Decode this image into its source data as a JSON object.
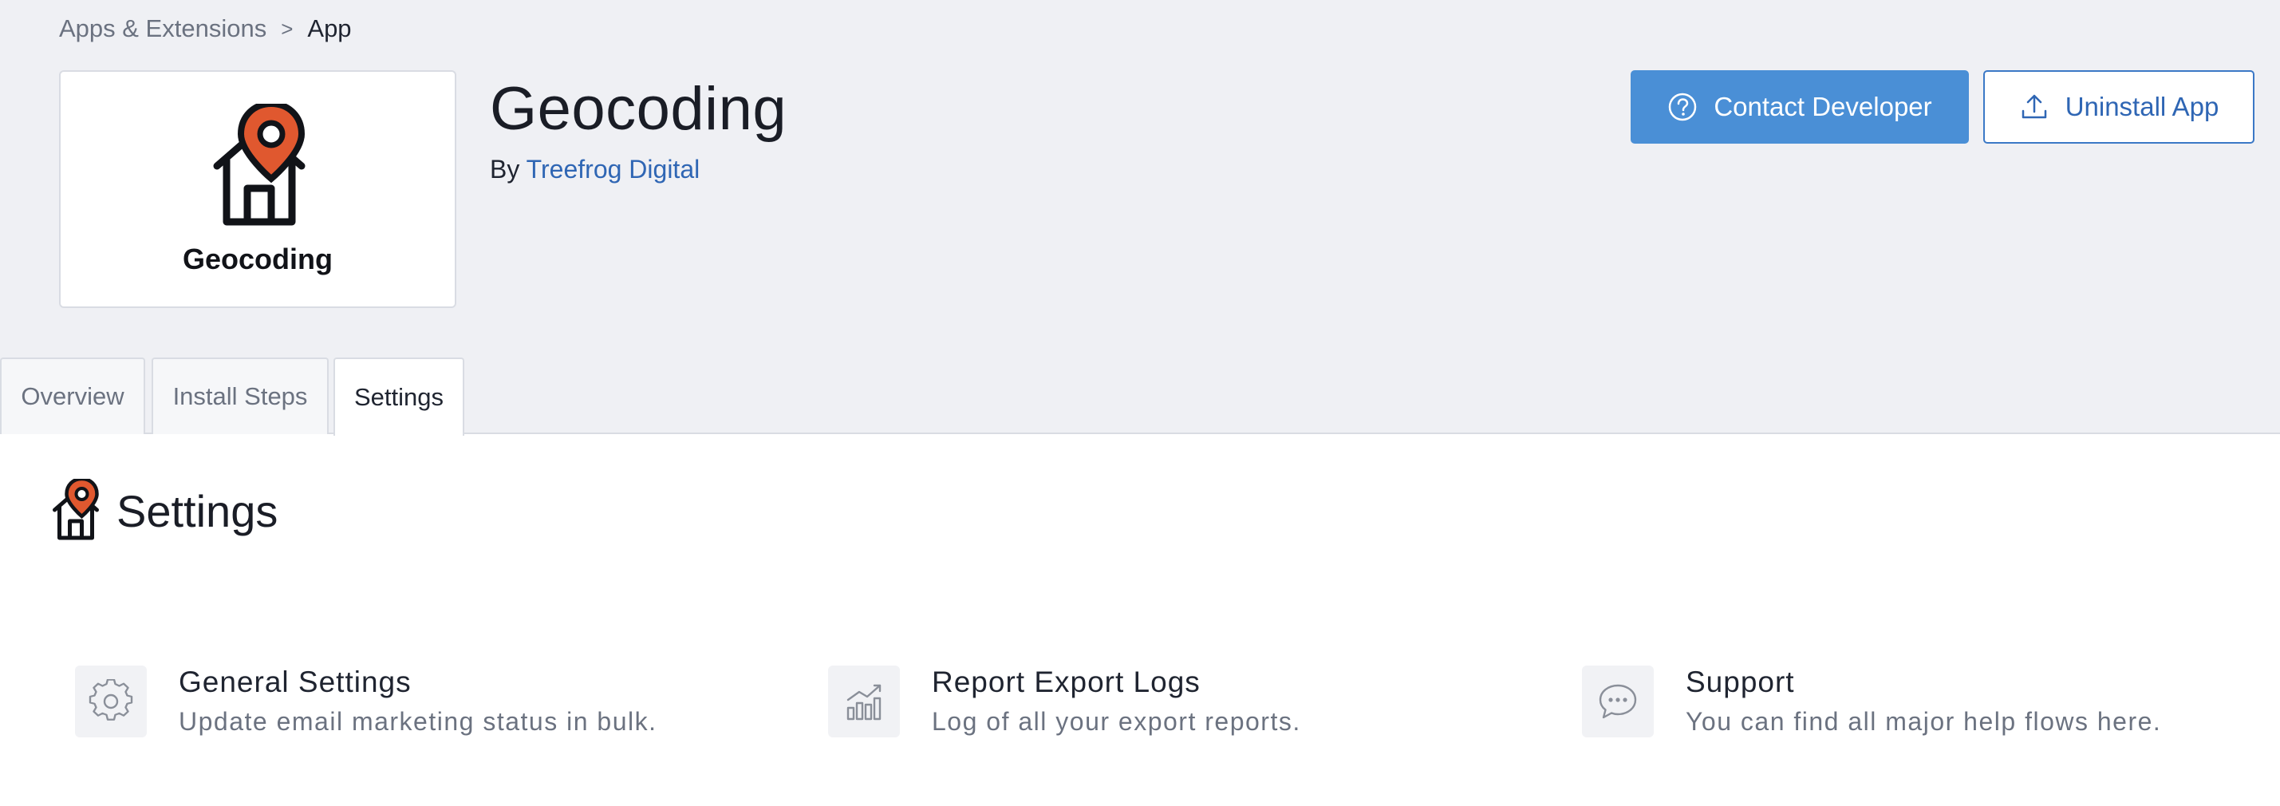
{
  "breadcrumb": {
    "parent": "Apps & Extensions",
    "separator": ">",
    "current": "App"
  },
  "app": {
    "logo_text": "Geocoding",
    "title": "Geocoding",
    "by_prefix": "By",
    "developer": "Treefrog Digital"
  },
  "actions": {
    "contact_label": "Contact Developer",
    "uninstall_label": "Uninstall App"
  },
  "tabs": [
    {
      "label": "Overview",
      "active": false
    },
    {
      "label": "Install Steps",
      "active": false
    },
    {
      "label": "Settings",
      "active": true
    }
  ],
  "section": {
    "title": "Settings"
  },
  "cards": [
    {
      "title": "General Settings",
      "description": "Update email marketing status in bulk.",
      "icon": "gear-icon"
    },
    {
      "title": "Report Export Logs",
      "description": "Log of all your export reports.",
      "icon": "chart-icon"
    },
    {
      "title": "Support",
      "description": "You can find all major help flows here.",
      "icon": "chat-bubble-icon"
    }
  ],
  "colors": {
    "header_bg": "#eff0f4",
    "primary": "#4a8fd6",
    "link": "#2f66b4",
    "pin_orange": "#e0582f"
  }
}
